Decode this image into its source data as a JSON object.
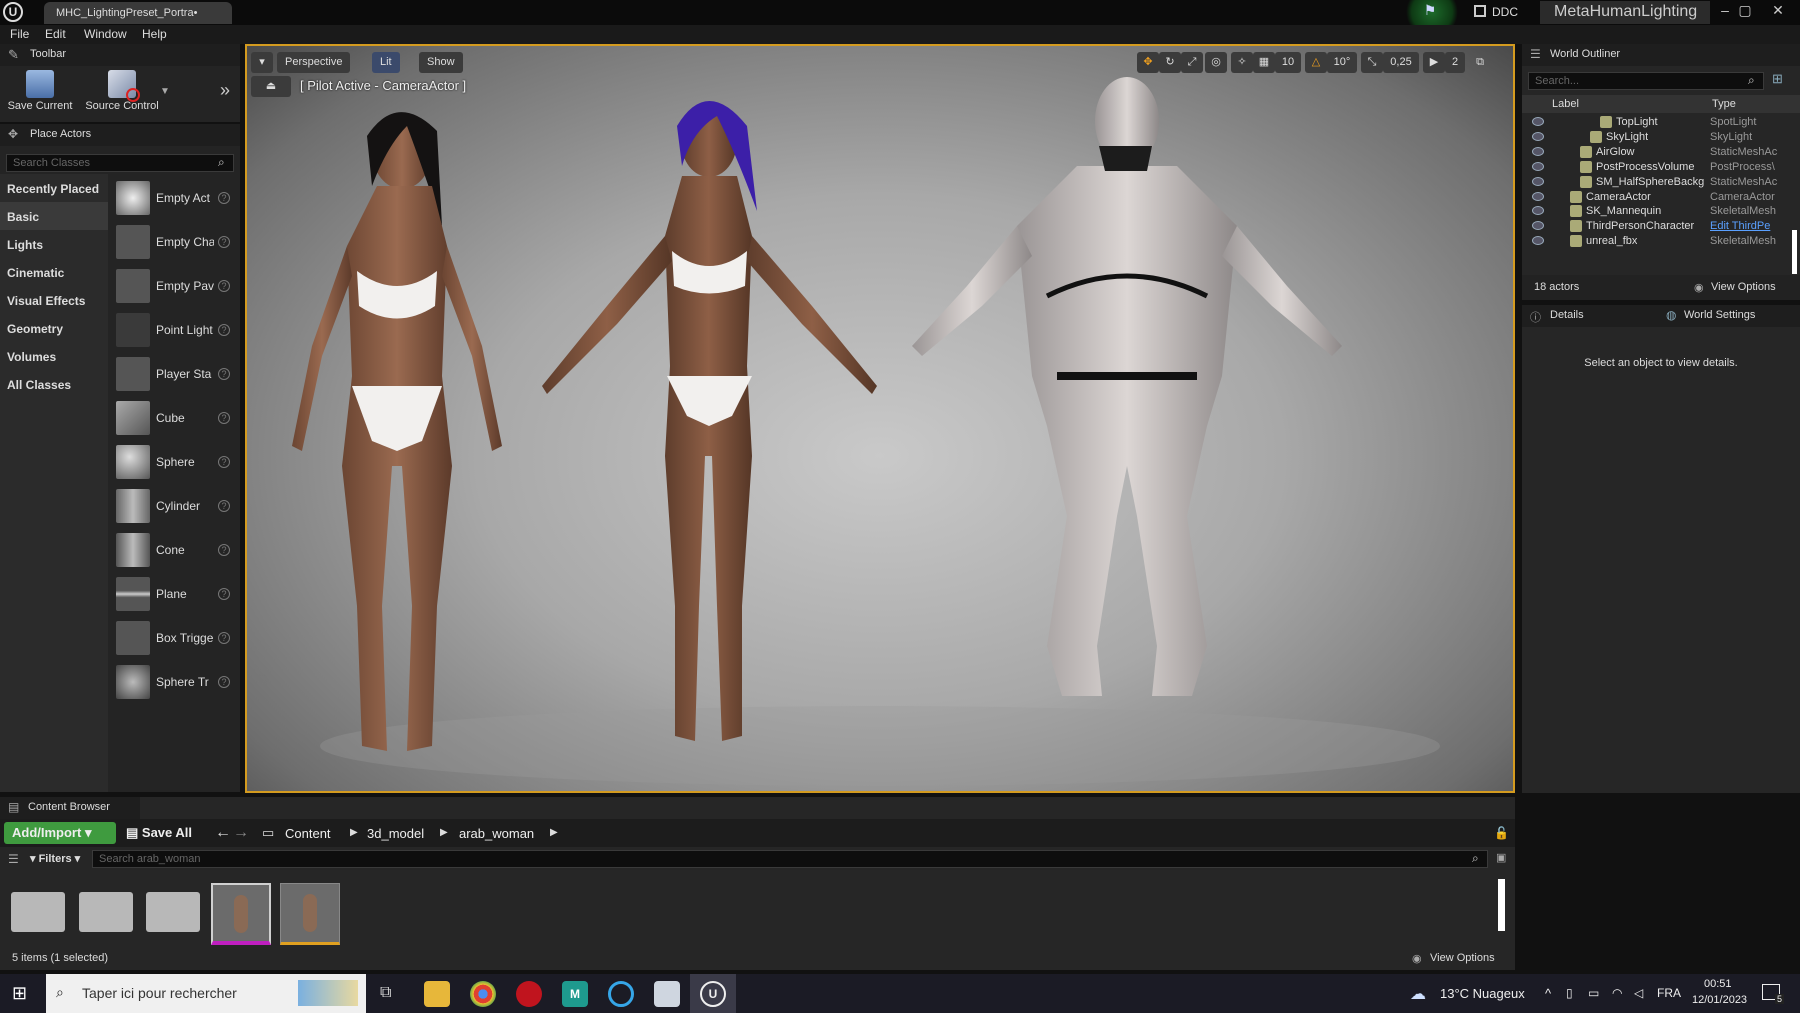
{
  "titlebar": {
    "doc_tab": "MHC_LightingPreset_Portra•",
    "ddc": "DDC",
    "project": "MetaHumanLighting",
    "min": "–",
    "max": "▢",
    "close": "✕"
  },
  "menu": [
    "File",
    "Edit",
    "Window",
    "Help"
  ],
  "toolbar": {
    "tab": "Toolbar",
    "save_current": "Save Current",
    "source_control": "Source Control"
  },
  "place_actors": {
    "tab": "Place Actors",
    "search_placeholder": "Search Classes",
    "categories": [
      "Recently Placed",
      "Basic",
      "Lights",
      "Cinematic",
      "Visual Effects",
      "Geometry",
      "Volumes",
      "All Classes"
    ],
    "selected_category": "Basic",
    "actors": [
      "Empty Act",
      "Empty Cha",
      "Empty Pav",
      "Point Light",
      "Player Sta",
      "Cube",
      "Sphere",
      "Cylinder",
      "Cone",
      "Plane",
      "Box Trigge",
      "Sphere Tr"
    ]
  },
  "viewport": {
    "perspective": "Perspective",
    "lit": "Lit",
    "show": "Show",
    "pilot": "[ Pilot Active - CameraActor ]",
    "grid_snap": "10",
    "rot_snap": "10°",
    "scale_snap": "0,25",
    "cam_speed": "2"
  },
  "outliner": {
    "tab": "World Outliner",
    "search_placeholder": "Search...",
    "col_label": "Label",
    "col_type": "Type",
    "rows": [
      {
        "name": "TopLight",
        "type": "SpotLight",
        "indent": 3
      },
      {
        "name": "SkyLight",
        "type": "SkyLight",
        "indent": 2
      },
      {
        "name": "AirGlow",
        "type": "StaticMeshAc",
        "indent": 1
      },
      {
        "name": "PostProcessVolume",
        "type": "PostProcess\\",
        "indent": 1
      },
      {
        "name": "SM_HalfSphereBackg",
        "type": "StaticMeshAc",
        "indent": 1
      },
      {
        "name": "CameraActor",
        "type": "CameraActor",
        "indent": 0
      },
      {
        "name": "SK_Mannequin",
        "type": "SkeletalMesh",
        "indent": 0
      },
      {
        "name": "ThirdPersonCharacter",
        "type": "Edit ThirdPe",
        "indent": 0
      },
      {
        "name": "unreal_fbx",
        "type": "SkeletalMesh",
        "indent": 0
      }
    ],
    "count": "18 actors",
    "view_options": "View Options"
  },
  "details": {
    "tab_details": "Details",
    "tab_world": "World Settings",
    "empty": "Select an object to view details."
  },
  "content_browser": {
    "tab": "Content Browser",
    "add_import": "Add/Import",
    "save_all": "Save All",
    "path": [
      "Content",
      "3d_model",
      "arab_woman"
    ],
    "filters": "Filters",
    "search_placeholder": "Search arab_woman",
    "status": "5 items (1 selected)",
    "view_options": "View Options"
  },
  "taskbar": {
    "search_placeholder": "Taper ici pour rechercher",
    "weather": "13°C  Nuageux",
    "lang": "FRA",
    "time": "00:51",
    "date": "12/01/2023",
    "notif": "5"
  }
}
